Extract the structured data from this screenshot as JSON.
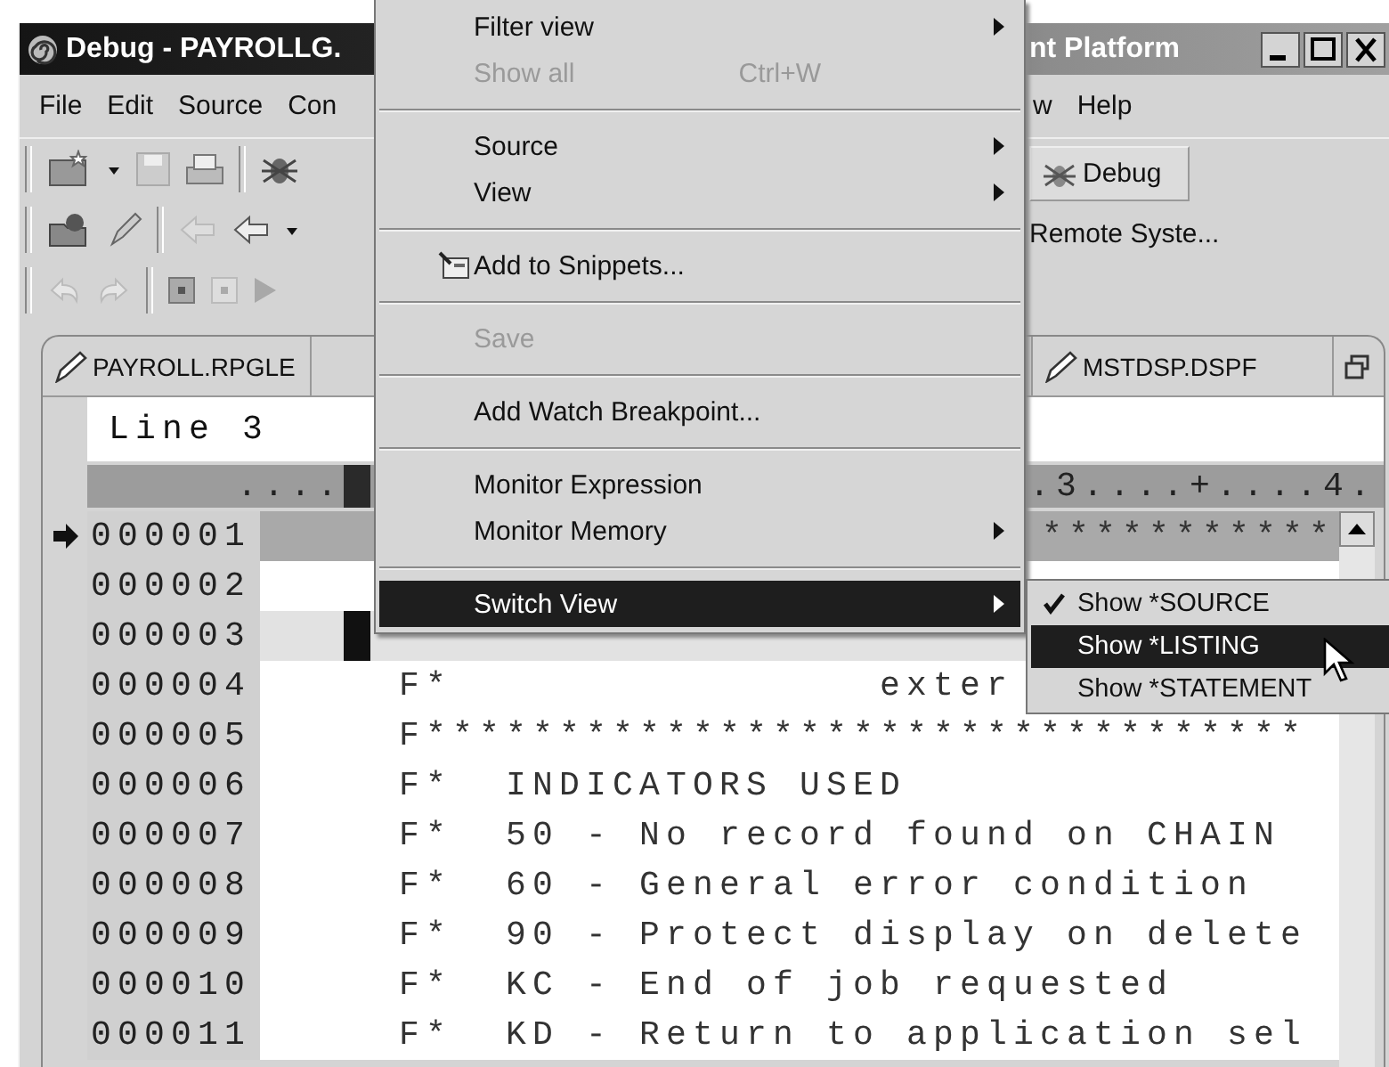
{
  "window": {
    "title": "Debug - PAYROLLG.",
    "title_tail": "nt Platform"
  },
  "menubar": {
    "items": [
      "File",
      "Edit",
      "Source",
      "Con"
    ],
    "items_right": [
      "w",
      "Help"
    ]
  },
  "perspective": {
    "label": "Debug"
  },
  "remote_label": "Remote Syste...",
  "editor": {
    "tabs": [
      "PAYROLL.RPGLE",
      "MSTDSP.DSPF"
    ],
    "line_field": "Line 3",
    "ruler_left": "....",
    "ruler_right": ".3....+....4.",
    "lines": [
      {
        "number": "000001",
        "text": "***********",
        "kind": "tail",
        "execution_point": true,
        "current": false
      },
      {
        "number": "000002",
        "kind": "text",
        "execution_point": false,
        "current": false
      },
      {
        "number": "000003",
        "kind": "text",
        "execution_point": false,
        "current": true
      },
      {
        "number": "000004",
        "text": "F*                exter",
        "kind": "text",
        "execution_point": false,
        "current": false
      },
      {
        "number": "000005",
        "text": "F*********************************",
        "kind": "text",
        "execution_point": false,
        "current": false
      },
      {
        "number": "000006",
        "text": "F*  INDICATORS USED",
        "kind": "text",
        "execution_point": false,
        "current": false
      },
      {
        "number": "000007",
        "text": "F*  50 - No record found on CHAIN",
        "kind": "text",
        "execution_point": false,
        "current": false
      },
      {
        "number": "000008",
        "text": "F*  60 - General error condition",
        "kind": "text",
        "execution_point": false,
        "current": false
      },
      {
        "number": "000009",
        "text": "F*  90 - Protect display on delete",
        "kind": "text",
        "execution_point": false,
        "current": false
      },
      {
        "number": "000010",
        "text": "F*  KC - End of job requested",
        "kind": "text",
        "execution_point": false,
        "current": false
      },
      {
        "number": "000011",
        "text": "F*  KD - Return to application sel",
        "kind": "text",
        "execution_point": false,
        "current": false
      }
    ]
  },
  "context_menu": {
    "items": [
      {
        "kind": "item",
        "label": "Filter view",
        "disabled": false,
        "submenu": true,
        "selected": false
      },
      {
        "kind": "item",
        "label": "Show all",
        "shortcut": "Ctrl+W",
        "disabled": true,
        "submenu": false,
        "selected": false
      },
      {
        "kind": "separator"
      },
      {
        "kind": "item",
        "label": "Source",
        "disabled": false,
        "submenu": true,
        "selected": false
      },
      {
        "kind": "item",
        "label": "View",
        "disabled": false,
        "submenu": true,
        "selected": false
      },
      {
        "kind": "separator"
      },
      {
        "kind": "item",
        "label": "Add to Snippets...",
        "has_icon": true,
        "disabled": false,
        "submenu": false,
        "selected": false
      },
      {
        "kind": "separator"
      },
      {
        "kind": "item",
        "label": "Save",
        "disabled": true,
        "submenu": false,
        "selected": false
      },
      {
        "kind": "separator"
      },
      {
        "kind": "item",
        "label": "Add Watch Breakpoint...",
        "disabled": false,
        "submenu": false,
        "selected": false
      },
      {
        "kind": "separator"
      },
      {
        "kind": "item",
        "label": "Monitor Expression",
        "disabled": false,
        "submenu": false,
        "selected": false
      },
      {
        "kind": "item",
        "label": "Monitor Memory",
        "disabled": false,
        "submenu": true,
        "selected": false
      },
      {
        "kind": "separator"
      },
      {
        "kind": "item",
        "label": "Switch View",
        "disabled": false,
        "submenu": true,
        "selected": true
      }
    ]
  },
  "submenu": {
    "items": [
      {
        "label": "Show *SOURCE",
        "checked": true,
        "selected": false
      },
      {
        "label": "Show *LISTING",
        "checked": false,
        "selected": true
      },
      {
        "label": "Show *STATEMENT",
        "checked": false,
        "selected": false
      }
    ]
  }
}
